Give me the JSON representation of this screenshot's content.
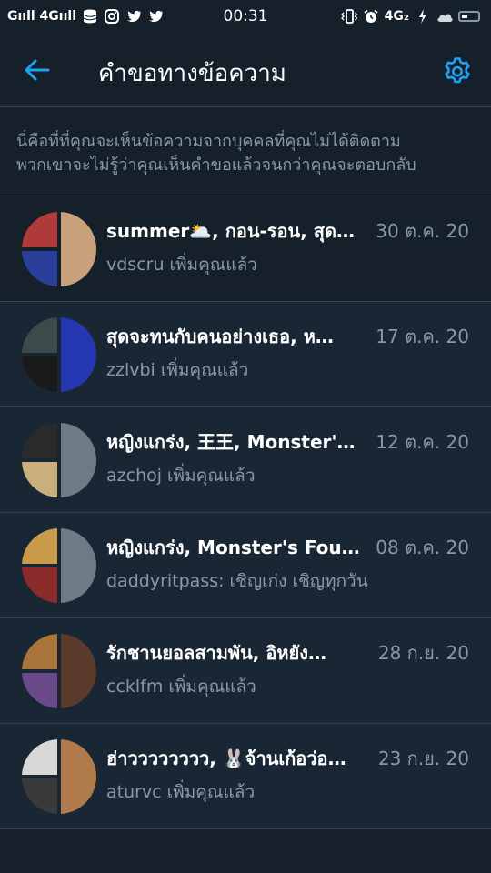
{
  "status_bar": {
    "signal_left": "Gııll 4Gııll",
    "time": "00:31",
    "network_right": "4G₂",
    "icons_left": [
      "sim-icon",
      "database-icon",
      "instagram-icon",
      "twitter-icon",
      "twitter-icon"
    ],
    "icons_right": [
      "vibrate-icon",
      "alarm-icon",
      "lightning-icon",
      "cloud-icon",
      "battery-icon"
    ]
  },
  "header": {
    "title": "คำขอทางข้อความ",
    "back_icon": "arrow-left-icon",
    "settings_icon": "gear-icon",
    "accent_color": "#1da1f2"
  },
  "info": {
    "line1": "นี่คือที่ที่คุณจะเห็นข้อความจากบุคคลที่คุณไม่ได้ติดตาม",
    "line2": "พวกเขาจะไม่รู้ว่าคุณเห็นคำขอแล้วจนกว่าคุณจะตอบกลับ"
  },
  "requests": [
    {
      "title": "summer🌥️, กอน-รอน, สุด…",
      "date": "30 ต.ค. 20",
      "subtitle": "vdscru เพิ่มคุณแล้ว",
      "avatar_colors": [
        "#b03a3a",
        "#2a3f9a",
        "#c8a27a"
      ]
    },
    {
      "title": "สุดจะทนกับคนอย่างเธอ, ห…",
      "date": "17 ต.ค. 20",
      "subtitle": "zzlvbi เพิ่มคุณแล้ว",
      "avatar_colors": [
        "#3d4a4a",
        "#1a1a1a",
        "#2436b0"
      ]
    },
    {
      "title": "หญิงแกร่ง, 王王, Monster'…",
      "date": "12 ต.ค. 20",
      "subtitle": "azchoj เพิ่มคุณแล้ว",
      "avatar_colors": [
        "#2a2a2a",
        "#c9b07a",
        "#6d7b86"
      ]
    },
    {
      "title": "หญิงแกร่ง, Monster's Fou…",
      "date": "08 ต.ค. 20",
      "subtitle": "daddyritpass: เชิญเก่ง เชิญทุกวัน",
      "avatar_colors": [
        "#c99a4a",
        "#8a2a2a",
        "#6d7b86"
      ]
    },
    {
      "title": "รักชานยอลสามพัน, อิหยัง…",
      "date": "28 ก.ย. 20",
      "subtitle": "ccklfm เพิ่มคุณแล้ว",
      "avatar_colors": [
        "#a8743a",
        "#6a4a8a",
        "#5a3a2a"
      ]
    },
    {
      "title": "ฮ่าวววววววว, 🐰จ้านเก้อว่อ…",
      "date": "23 ก.ย. 20",
      "subtitle": "aturvc เพิ่มคุณแล้ว",
      "avatar_colors": [
        "#d8d8d8",
        "#3a3a3a",
        "#b07a4a"
      ]
    }
  ]
}
